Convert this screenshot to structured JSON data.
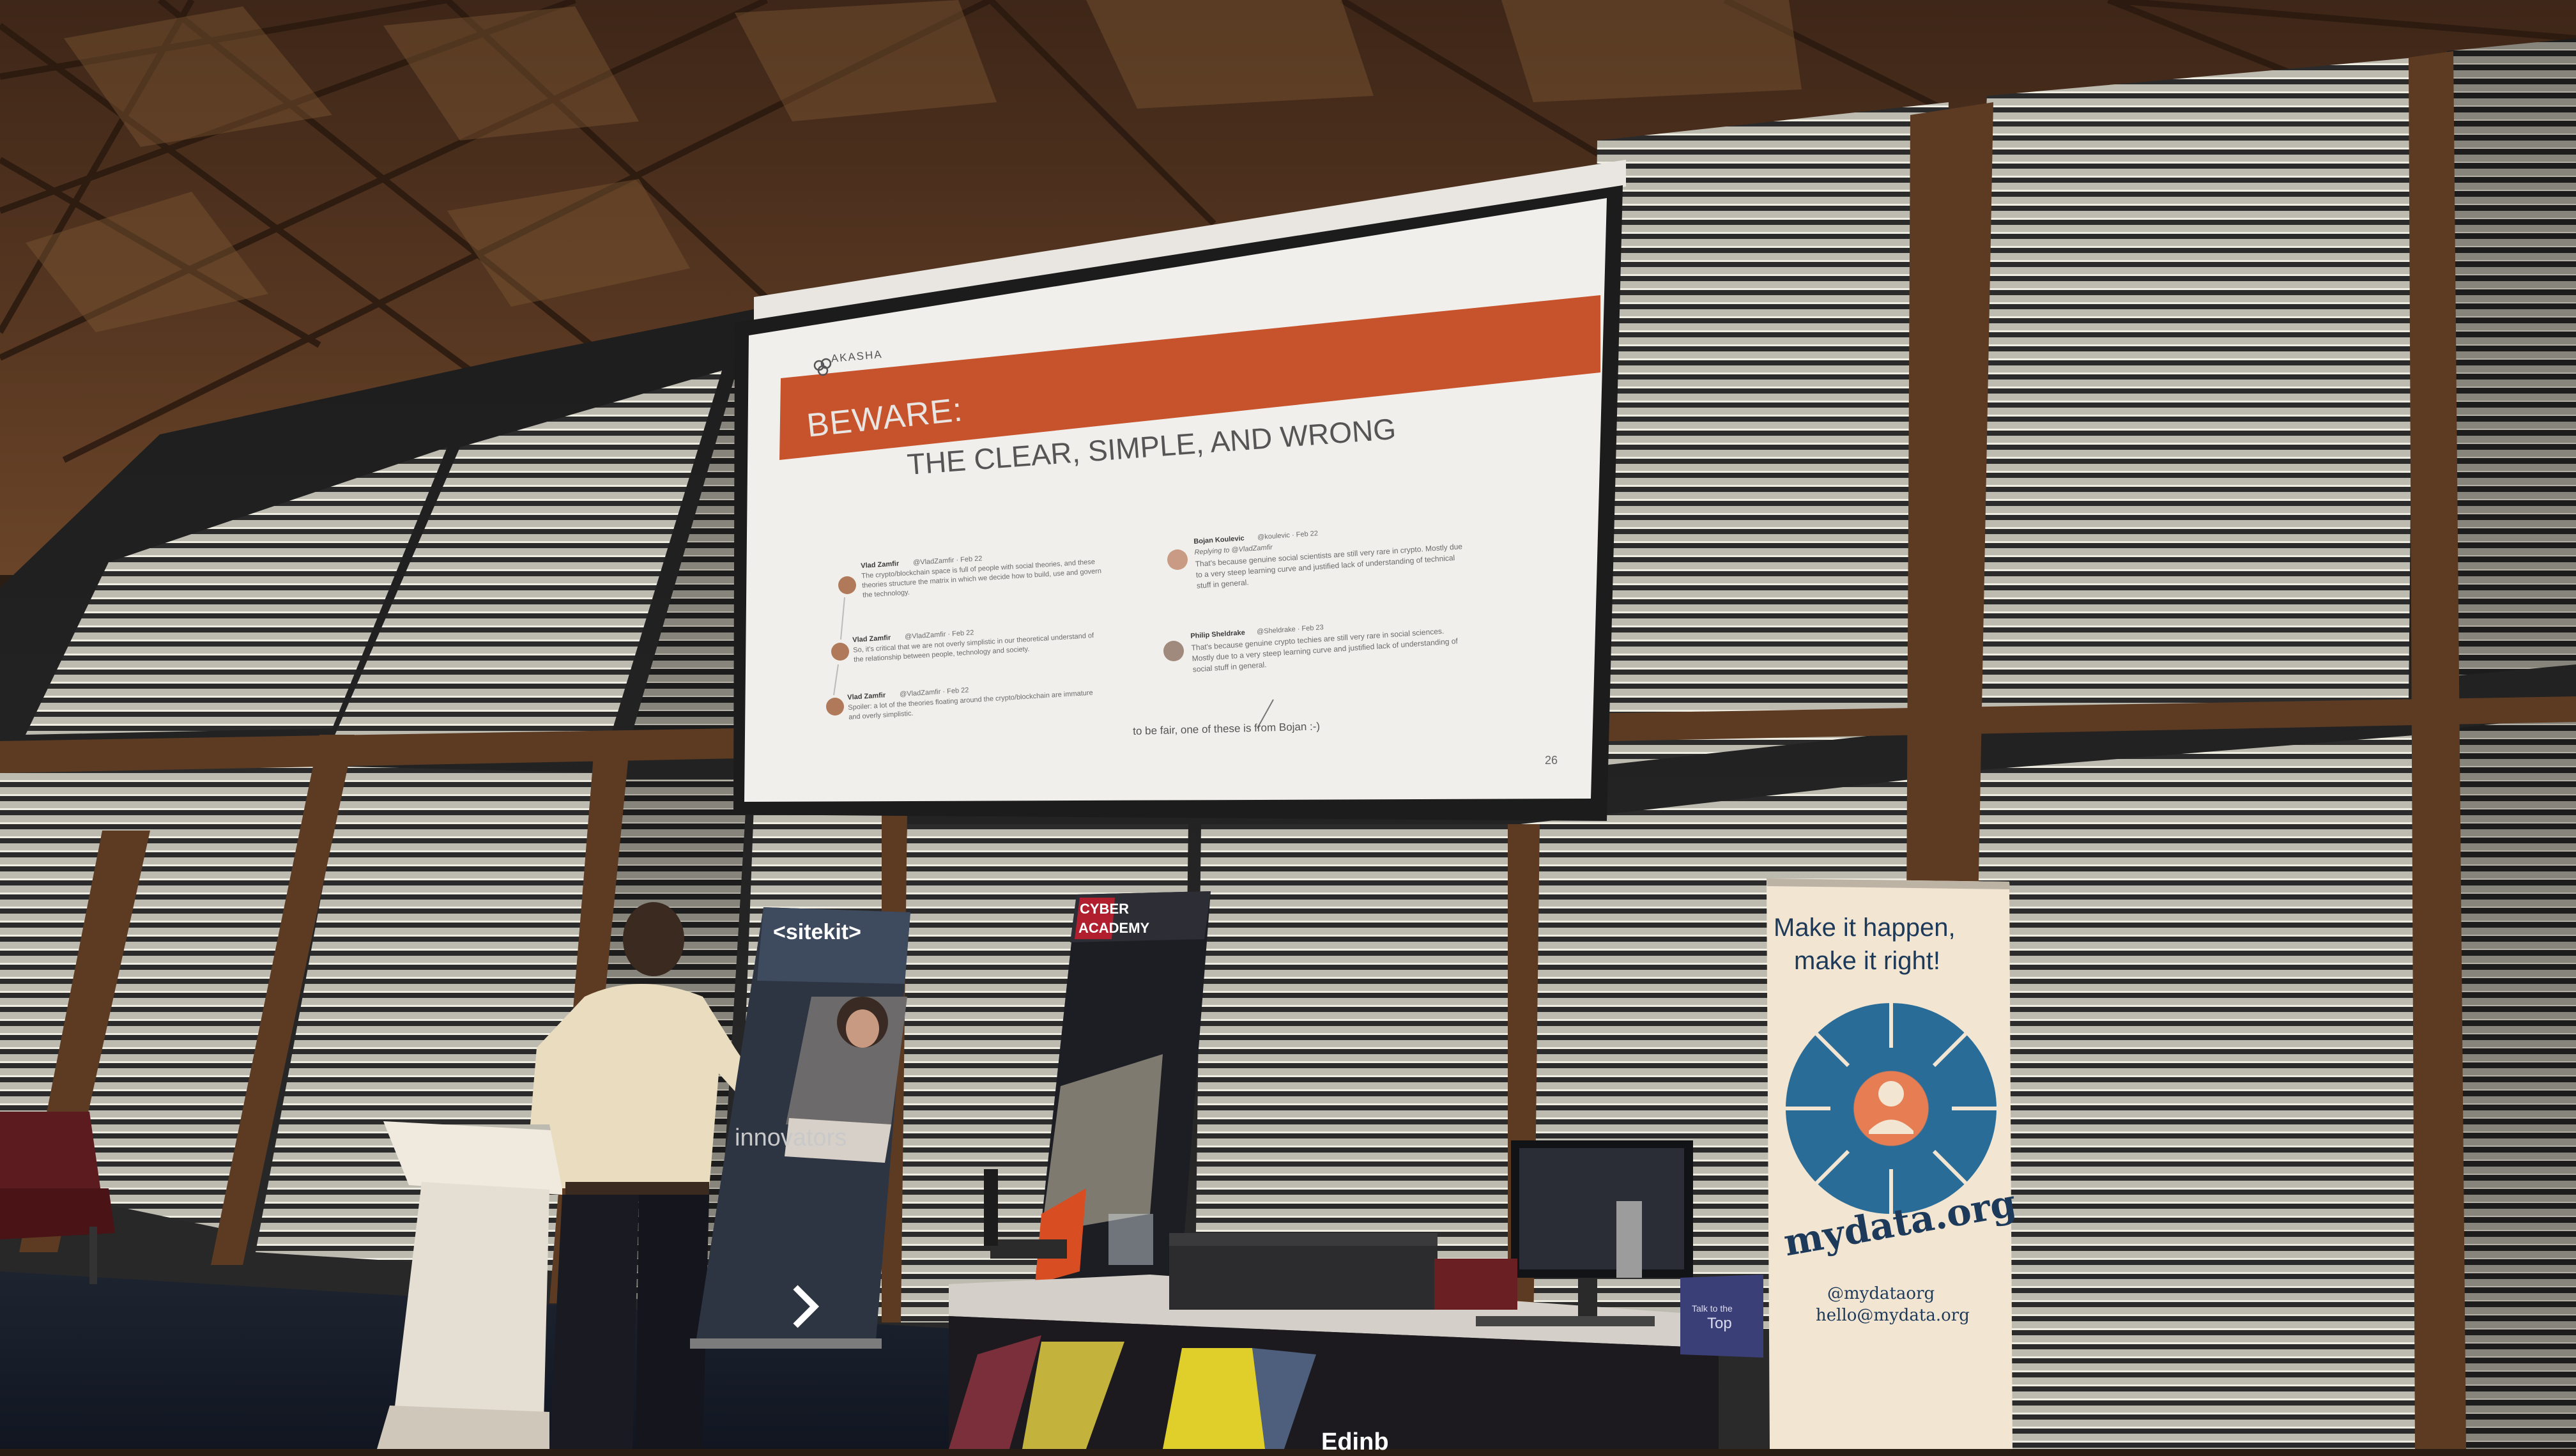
{
  "slide": {
    "brand": "AKASHA",
    "heading": "BEWARE:",
    "subheading": "THE CLEAR, SIMPLE, AND WRONG",
    "page_number": "26",
    "footnote": "to be fair, one of these is from Bojan :-)",
    "left_tweets": [
      {
        "author": "Vlad Zamfir",
        "meta": "@VladZamfir · Feb 22",
        "lines": [
          "The crypto/blockchain space is full of people with social theories, and these",
          "theories structure the matrix in which we decide how to build, use and govern",
          "the technology."
        ]
      },
      {
        "author": "Vlad Zamfir",
        "meta": "@VladZamfir · Feb 22",
        "lines": [
          "So, it's critical that we are not overly simplistic in our theoretical understand of",
          "the relationship between people, technology and society."
        ]
      },
      {
        "author": "Vlad Zamfir",
        "meta": "@VladZamfir · Feb 22",
        "lines": [
          "Spoiler: a lot of the theories floating around the crypto/blockchain are immature",
          "and overly simplistic."
        ]
      }
    ],
    "right_tweets": [
      {
        "author": "Bojan Koulevic",
        "meta": "@koulevic · Feb 22",
        "lines": [
          "Replying to @VladZamfir",
          "That's because genuine social scientists are still very rare in crypto. Mostly due",
          "to a very steep learning curve and justified lack of understanding of technical",
          "stuff in general."
        ]
      },
      {
        "author": "Philip Sheldrake",
        "meta": "@Sheldrake · Feb 23",
        "lines": [
          "That's because genuine crypto techies are still very rare in social sciences.",
          "Mostly due to a very steep learning curve and justified lack of understanding of",
          "social stuff in general."
        ]
      }
    ]
  },
  "banners": {
    "sitekit_logo": "<sitekit>",
    "sitekit_tagline": "innovators",
    "cyber_logo_line1": "CYBER",
    "cyber_logo_line2": "ACADEMY",
    "mydata_headline_1": "Make it happen,",
    "mydata_headline_2": "make it right!",
    "mydata_brand": "mydata.org",
    "mydata_handle": "@mydataorg",
    "mydata_email": "hello@mydata.org"
  },
  "stage": {
    "desk_text": "Edinb",
    "sign_text_1": "Talk to the",
    "sign_text_2": "Top"
  },
  "colors": {
    "slide_banner": "#c7532c",
    "slide_bg": "#f1efec",
    "screen_frame": "#1c1c1c",
    "dome_wood": "#5b3a24",
    "blinds": "#d6d2c6",
    "mydata_wheel": "#2a6c98"
  }
}
